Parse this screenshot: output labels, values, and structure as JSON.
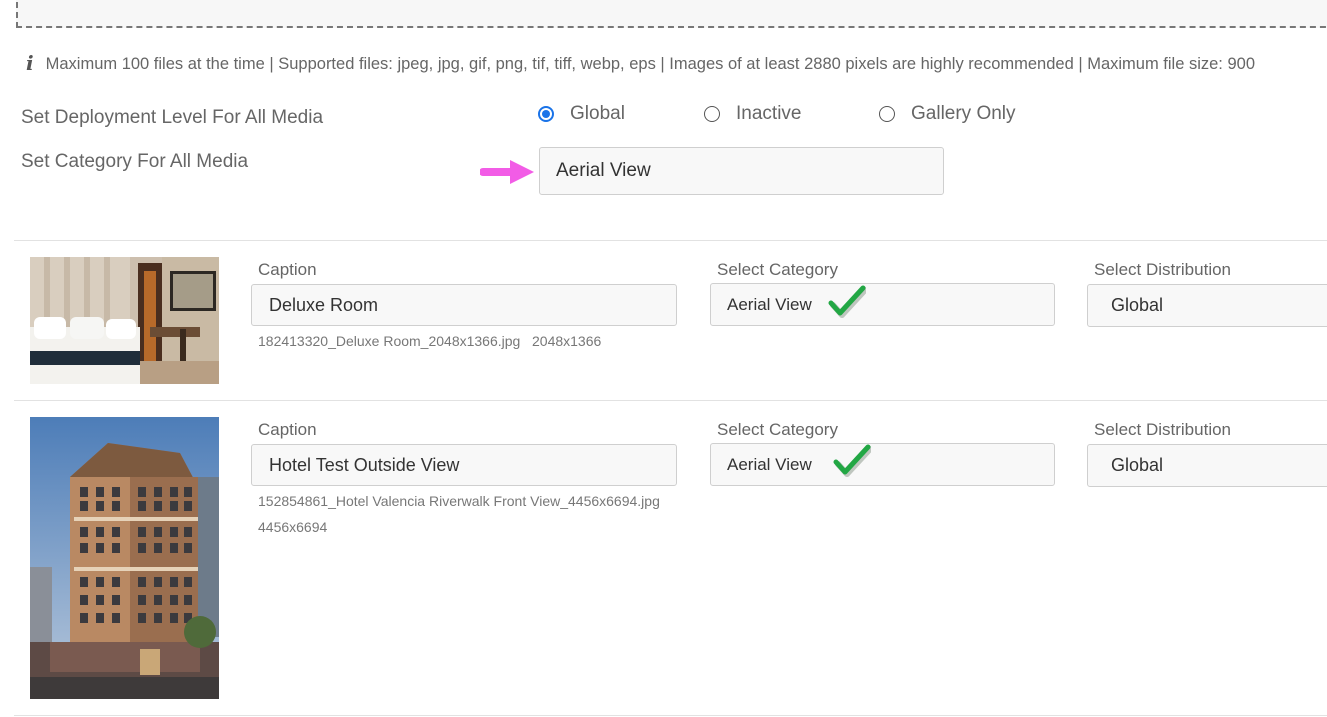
{
  "info": {
    "icon": "info-icon",
    "text": "Maximum 100 files at the time | Supported files: jpeg, jpg, gif, png, tif, tiff, webp, eps | Images of at least 2880 pixels are highly recommended | Maximum file size: 900"
  },
  "deployment": {
    "label": "Set Deployment Level For All Media",
    "options": [
      {
        "label": "Global",
        "checked": true
      },
      {
        "label": "Inactive",
        "checked": false
      },
      {
        "label": "Gallery Only",
        "checked": false
      }
    ]
  },
  "category_all": {
    "label": "Set Category For All Media",
    "value": "Aerial View"
  },
  "media": [
    {
      "caption_label": "Caption",
      "caption": "Deluxe Room",
      "filename": "182413320_Deluxe Room_2048x1366.jpg",
      "dimensions": "2048x1366",
      "category_label": "Select Category",
      "category": "Aerial View",
      "distribution_label": "Select Distribution",
      "distribution": "Global"
    },
    {
      "caption_label": "Caption",
      "caption": "Hotel Test Outside View",
      "filename": "152854861_Hotel Valencia Riverwalk Front View_4456x6694.jpg",
      "dimensions": "4456x6694",
      "category_label": "Select Category",
      "category": "Aerial View",
      "distribution_label": "Select Distribution",
      "distribution": "Global"
    }
  ],
  "colors": {
    "accent": "#1a73e8",
    "arrow": "#f25ce6",
    "check": "#22a744"
  }
}
